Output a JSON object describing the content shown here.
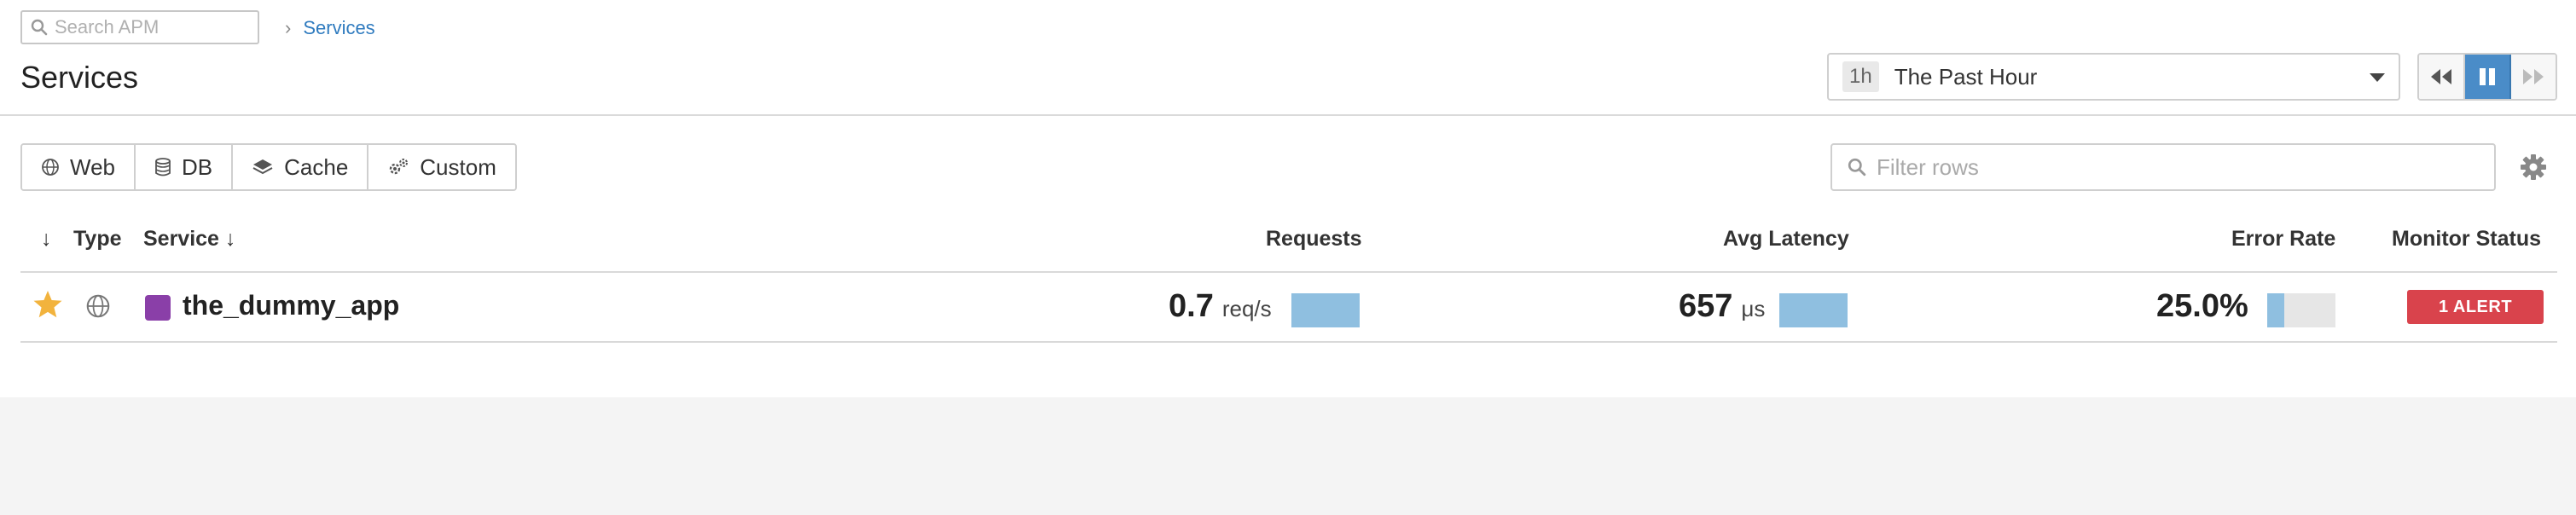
{
  "colors": {
    "link": "#2f7bbf",
    "accent_blue": "#4a8cc8",
    "bar_fill": "#8fbfe0",
    "bar_track": "#e6e6e6",
    "alert_red": "#d9434c",
    "star": "#f2b33d",
    "service_swatch": "#8a3fa8",
    "background_bottom": "#f4f4f4"
  },
  "search": {
    "placeholder": "Search APM",
    "icon": "search-icon"
  },
  "breadcrumb": {
    "items": [
      "Services"
    ]
  },
  "page": {
    "title": "Services"
  },
  "timeframe": {
    "badge": "1h",
    "label": "The Past Hour"
  },
  "playback": {
    "icons": [
      "rewind-icon",
      "pause-icon",
      "fast-forward-icon"
    ],
    "active": "pause"
  },
  "type_filters": [
    {
      "label": "Web",
      "icon": "globe-icon"
    },
    {
      "label": "DB",
      "icon": "database-icon"
    },
    {
      "label": "Cache",
      "icon": "layers-icon"
    },
    {
      "label": "Custom",
      "icon": "gears-icon"
    }
  ],
  "filter_rows": {
    "placeholder": "Filter rows",
    "icon": "search-icon"
  },
  "settings": {
    "icon": "gear-icon"
  },
  "table": {
    "headers": {
      "sort": "↓",
      "type": "Type",
      "service": "Service ↓",
      "requests": "Requests",
      "latency": "Avg Latency",
      "error_rate": "Error Rate",
      "monitor_status": "Monitor Status"
    },
    "rows": [
      {
        "starred": true,
        "type_icon": "globe-icon",
        "service": "the_dummy_app",
        "requests": {
          "value": "0.7",
          "unit": "req/s",
          "bar_fraction": 1.0
        },
        "latency": {
          "value": "657",
          "unit": "μs",
          "bar_fraction": 1.0
        },
        "error_rate": {
          "value": "25.0%",
          "bar_fraction": 0.25
        },
        "monitor_status": "1 ALERT"
      }
    ]
  }
}
